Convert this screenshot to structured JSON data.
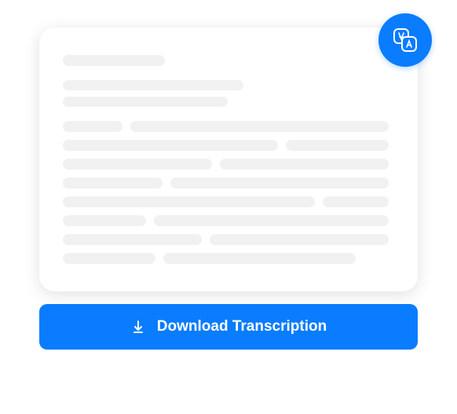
{
  "download_button": {
    "label": "Download Transcription"
  },
  "icons": {
    "translate": "translate-icon",
    "download": "download-icon"
  }
}
